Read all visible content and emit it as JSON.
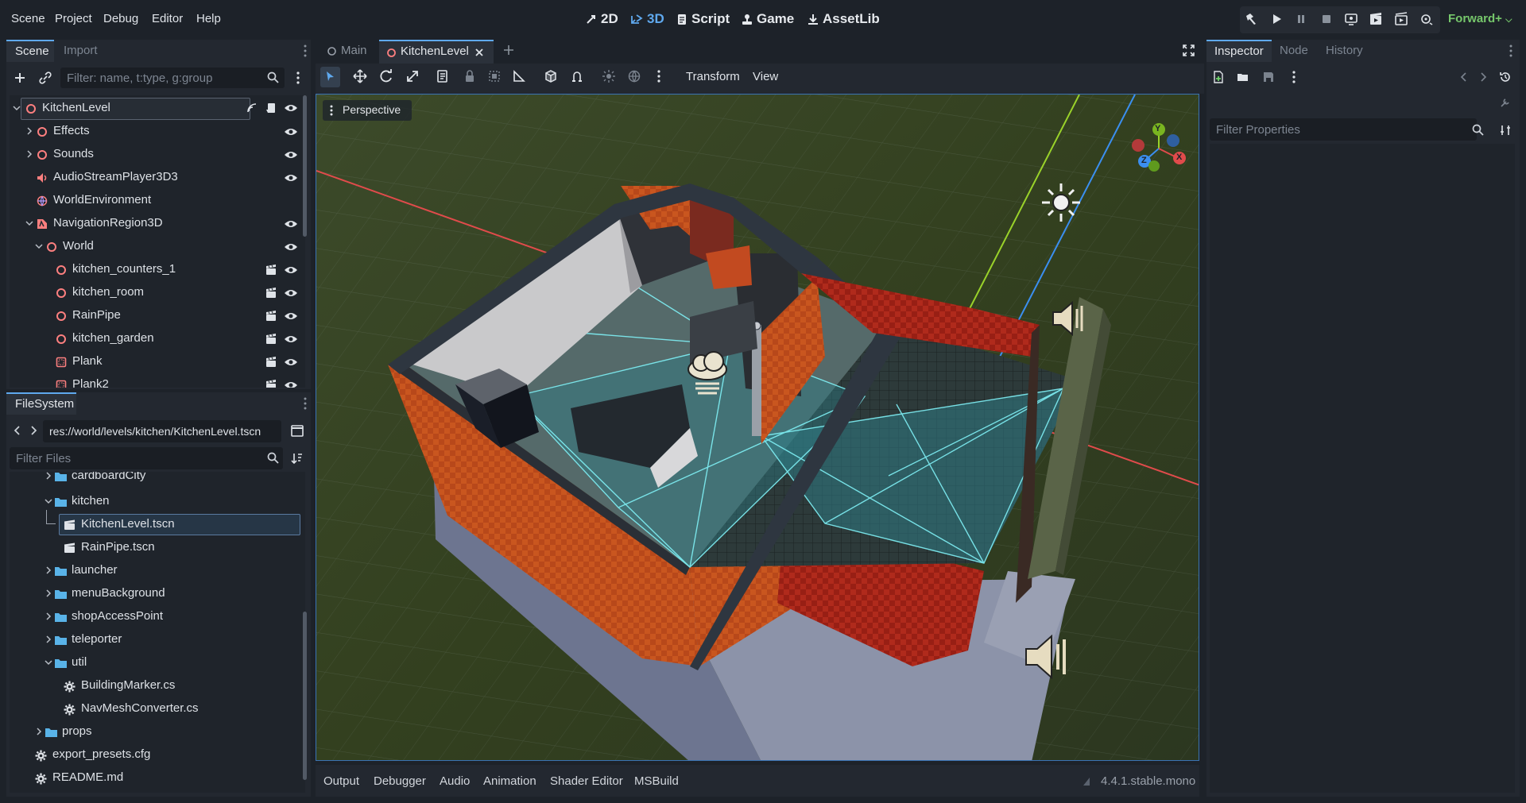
{
  "menu": [
    "Scene",
    "Project",
    "Debug",
    "Editor",
    "Help"
  ],
  "workspaces": [
    {
      "label": "2D",
      "active": false
    },
    {
      "label": "3D",
      "active": true
    },
    {
      "label": "Script",
      "active": false
    },
    {
      "label": "Game",
      "active": false
    },
    {
      "label": "AssetLib",
      "active": false
    }
  ],
  "renderer": "Forward+",
  "scene_dock": {
    "tabs": [
      "Scene",
      "Import"
    ],
    "filter_placeholder": "Filter: name, t:type, g:group",
    "tree": [
      {
        "label": "KitchenLevel",
        "icon": "node3d-icon",
        "selected": true
      },
      {
        "label": "Effects",
        "icon": "node3d-icon"
      },
      {
        "label": "Sounds",
        "icon": "node3d-icon"
      },
      {
        "label": "AudioStreamPlayer3D3",
        "icon": "audio-icon"
      },
      {
        "label": "WorldEnvironment",
        "icon": "globe-icon"
      },
      {
        "label": "NavigationRegion3D",
        "icon": "navregion-icon"
      },
      {
        "label": "World",
        "icon": "node3d-icon"
      },
      {
        "label": "kitchen_counters_1",
        "icon": "node3d-icon"
      },
      {
        "label": "kitchen_room",
        "icon": "node3d-icon"
      },
      {
        "label": "RainPipe",
        "icon": "node3d-icon"
      },
      {
        "label": "kitchen_garden",
        "icon": "node3d-icon"
      },
      {
        "label": "Plank",
        "icon": "body-icon"
      },
      {
        "label": "Plank2",
        "icon": "body-icon"
      }
    ]
  },
  "filesystem": {
    "title": "FileSystem",
    "path": "res://world/levels/kitchen/KitchenLevel.tscn",
    "filter_placeholder": "Filter Files",
    "items": [
      {
        "label": "cardboardCity",
        "type": "folder"
      },
      {
        "label": "kitchen",
        "type": "folder"
      },
      {
        "label": "KitchenLevel.tscn",
        "type": "scene",
        "selected": true
      },
      {
        "label": "RainPipe.tscn",
        "type": "scene"
      },
      {
        "label": "launcher",
        "type": "folder"
      },
      {
        "label": "menuBackground",
        "type": "folder"
      },
      {
        "label": "shopAccessPoint",
        "type": "folder"
      },
      {
        "label": "teleporter",
        "type": "folder"
      },
      {
        "label": "util",
        "type": "folder"
      },
      {
        "label": "BuildingMarker.cs",
        "type": "script"
      },
      {
        "label": "NavMeshConverter.cs",
        "type": "script"
      },
      {
        "label": "props",
        "type": "folder"
      },
      {
        "label": "export_presets.cfg",
        "type": "config"
      },
      {
        "label": "README.md",
        "type": "config"
      }
    ]
  },
  "editor_tabs": [
    {
      "label": "Main",
      "active": false
    },
    {
      "label": "KitchenLevel",
      "active": true
    }
  ],
  "viewport": {
    "menus": [
      "Transform",
      "View"
    ],
    "perspective_label": "Perspective",
    "gizmo_axes": [
      "Y",
      "Z",
      "X"
    ]
  },
  "bottom_tabs": [
    "Output",
    "Debugger",
    "Audio",
    "Animation",
    "Shader Editor",
    "MSBuild"
  ],
  "version": "4.4.1.stable.mono",
  "inspector": {
    "tabs": [
      "Inspector",
      "Node",
      "History"
    ],
    "filter_placeholder": "Filter Properties"
  },
  "colors": {
    "accent": "#5fa9ee",
    "node3d": "#fc7f7f",
    "renderer": "#76c76b",
    "folder": "#59b3e8"
  }
}
